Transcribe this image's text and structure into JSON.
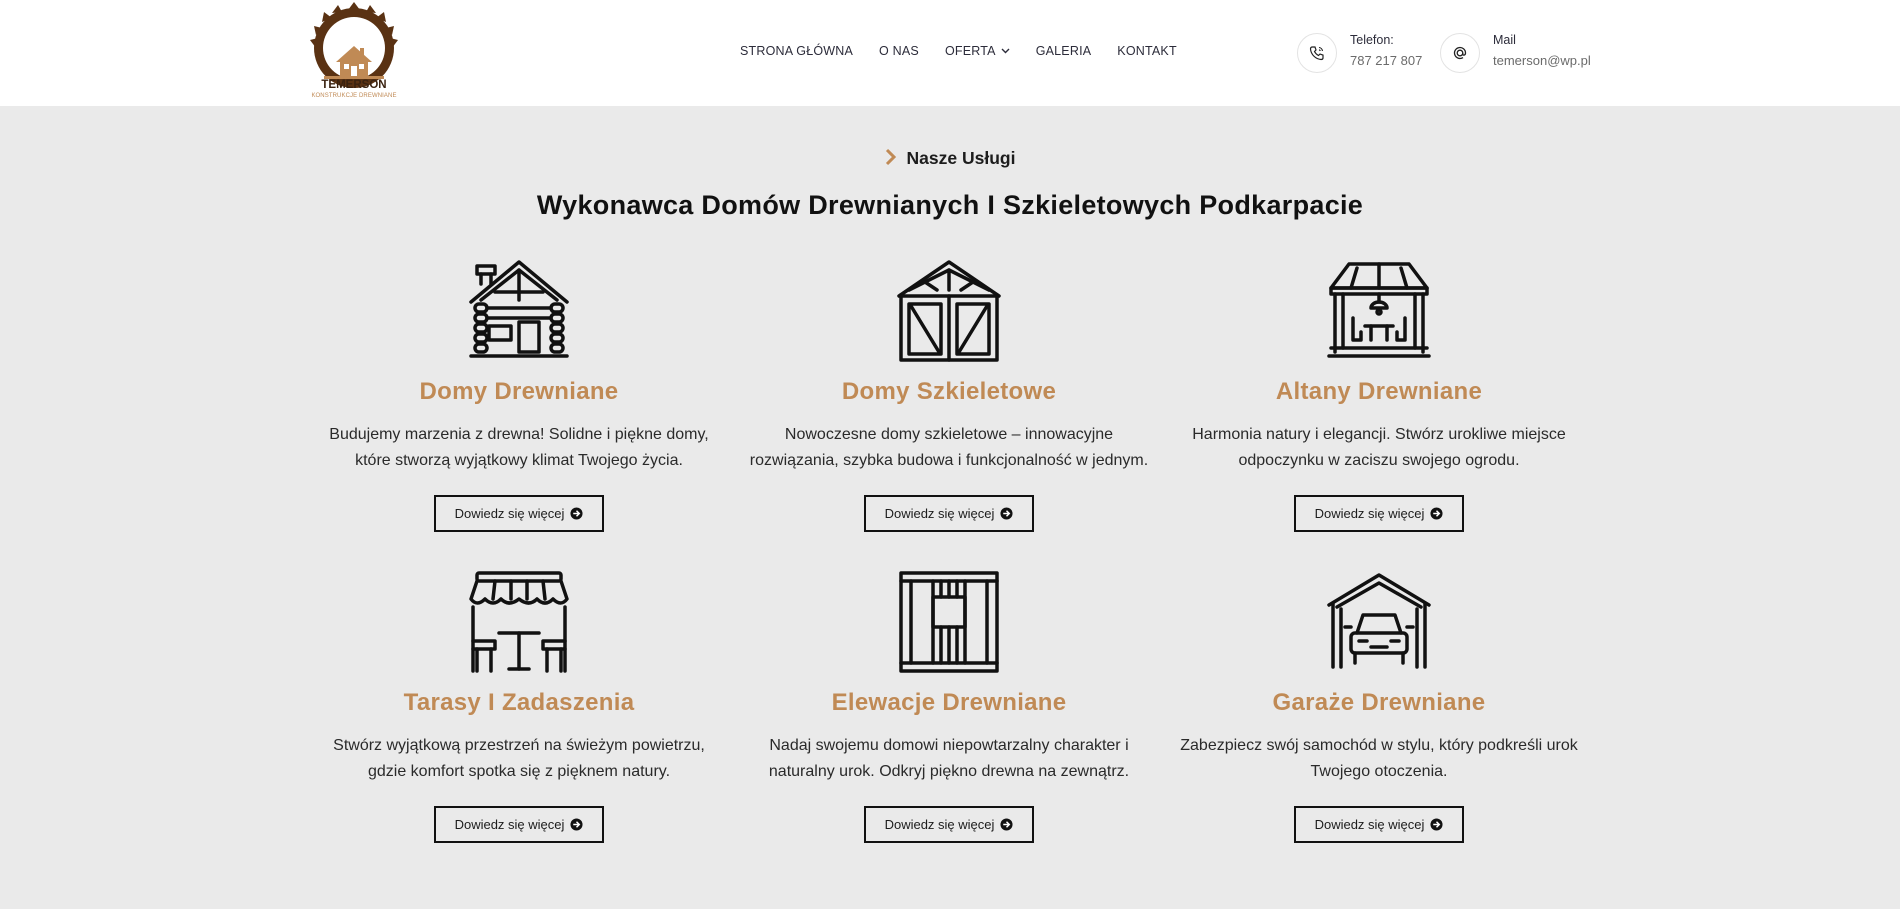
{
  "header": {
    "logo_text": "TEMERSON",
    "logo_subtext": "KONSTRUKCJE DREWNIANE",
    "nav": [
      {
        "label": "STRONA GŁÓWNA",
        "has_dropdown": false
      },
      {
        "label": "O NAS",
        "has_dropdown": false
      },
      {
        "label": "OFERTA",
        "has_dropdown": true
      },
      {
        "label": "GALERIA",
        "has_dropdown": false
      },
      {
        "label": "KONTAKT",
        "has_dropdown": false
      }
    ],
    "phone": {
      "label": "Telefon:",
      "value": "787 217 807",
      "icon": "phone-icon"
    },
    "mail": {
      "label": "Mail",
      "value": "temerson@wp.pl",
      "icon": "at-icon"
    }
  },
  "section": {
    "eyebrow": "Nasze Usługi",
    "heading": "Wykonawca Domów Drewnianych I Szkieletowych Podkarpacie"
  },
  "services": [
    {
      "title": "Domy Drewniane",
      "desc_line1": "Budujemy marzenia z drewna! Solidne i piękne domy,",
      "desc_line2": "które stworzą wyjątkowy klimat Twojego życia.",
      "button": "Dowiedz się więcej",
      "icon": "log-house-icon"
    },
    {
      "title": "Domy Szkieletowe",
      "desc_line1": "Nowoczesne domy szkieletowe – innowacyjne",
      "desc_line2": "rozwiązania, szybka budowa i funkcjonalność w jednym.",
      "button": "Dowiedz się więcej",
      "icon": "frame-house-icon"
    },
    {
      "title": "Altany Drewniane",
      "desc_line1": "Harmonia natury i elegancji. Stwórz urokliwe miejsce",
      "desc_line2": "odpoczynku w zaciszu swojego ogrodu.",
      "button": "Dowiedz się więcej",
      "icon": "gazebo-icon"
    },
    {
      "title": "Tarasy I Zadaszenia",
      "desc_line1": "Stwórz wyjątkową przestrzeń na świeżym powietrzu,",
      "desc_line2": "gdzie komfort spotka się z pięknem natury.",
      "button": "Dowiedz się więcej",
      "icon": "terrace-icon"
    },
    {
      "title": "Elewacje Drewniane",
      "desc_line1": "Nadaj swojemu domowi niepowtarzalny charakter i",
      "desc_line2": "naturalny urok. Odkryj piękno drewna na zewnątrz.",
      "button": "Dowiedz się więcej",
      "icon": "wood-facade-icon"
    },
    {
      "title": "Garaże Drewniane",
      "desc_line1": "Zabezpiecz swój samochód w stylu, który podkreśli urok",
      "desc_line2": "Twojego otoczenia.",
      "button": "Dowiedz się więcej",
      "icon": "garage-icon"
    }
  ],
  "colors": {
    "accent": "#c08a55",
    "background": "#eaeaea",
    "text": "#1b1b1b",
    "logo_brown": "#5a3213"
  }
}
